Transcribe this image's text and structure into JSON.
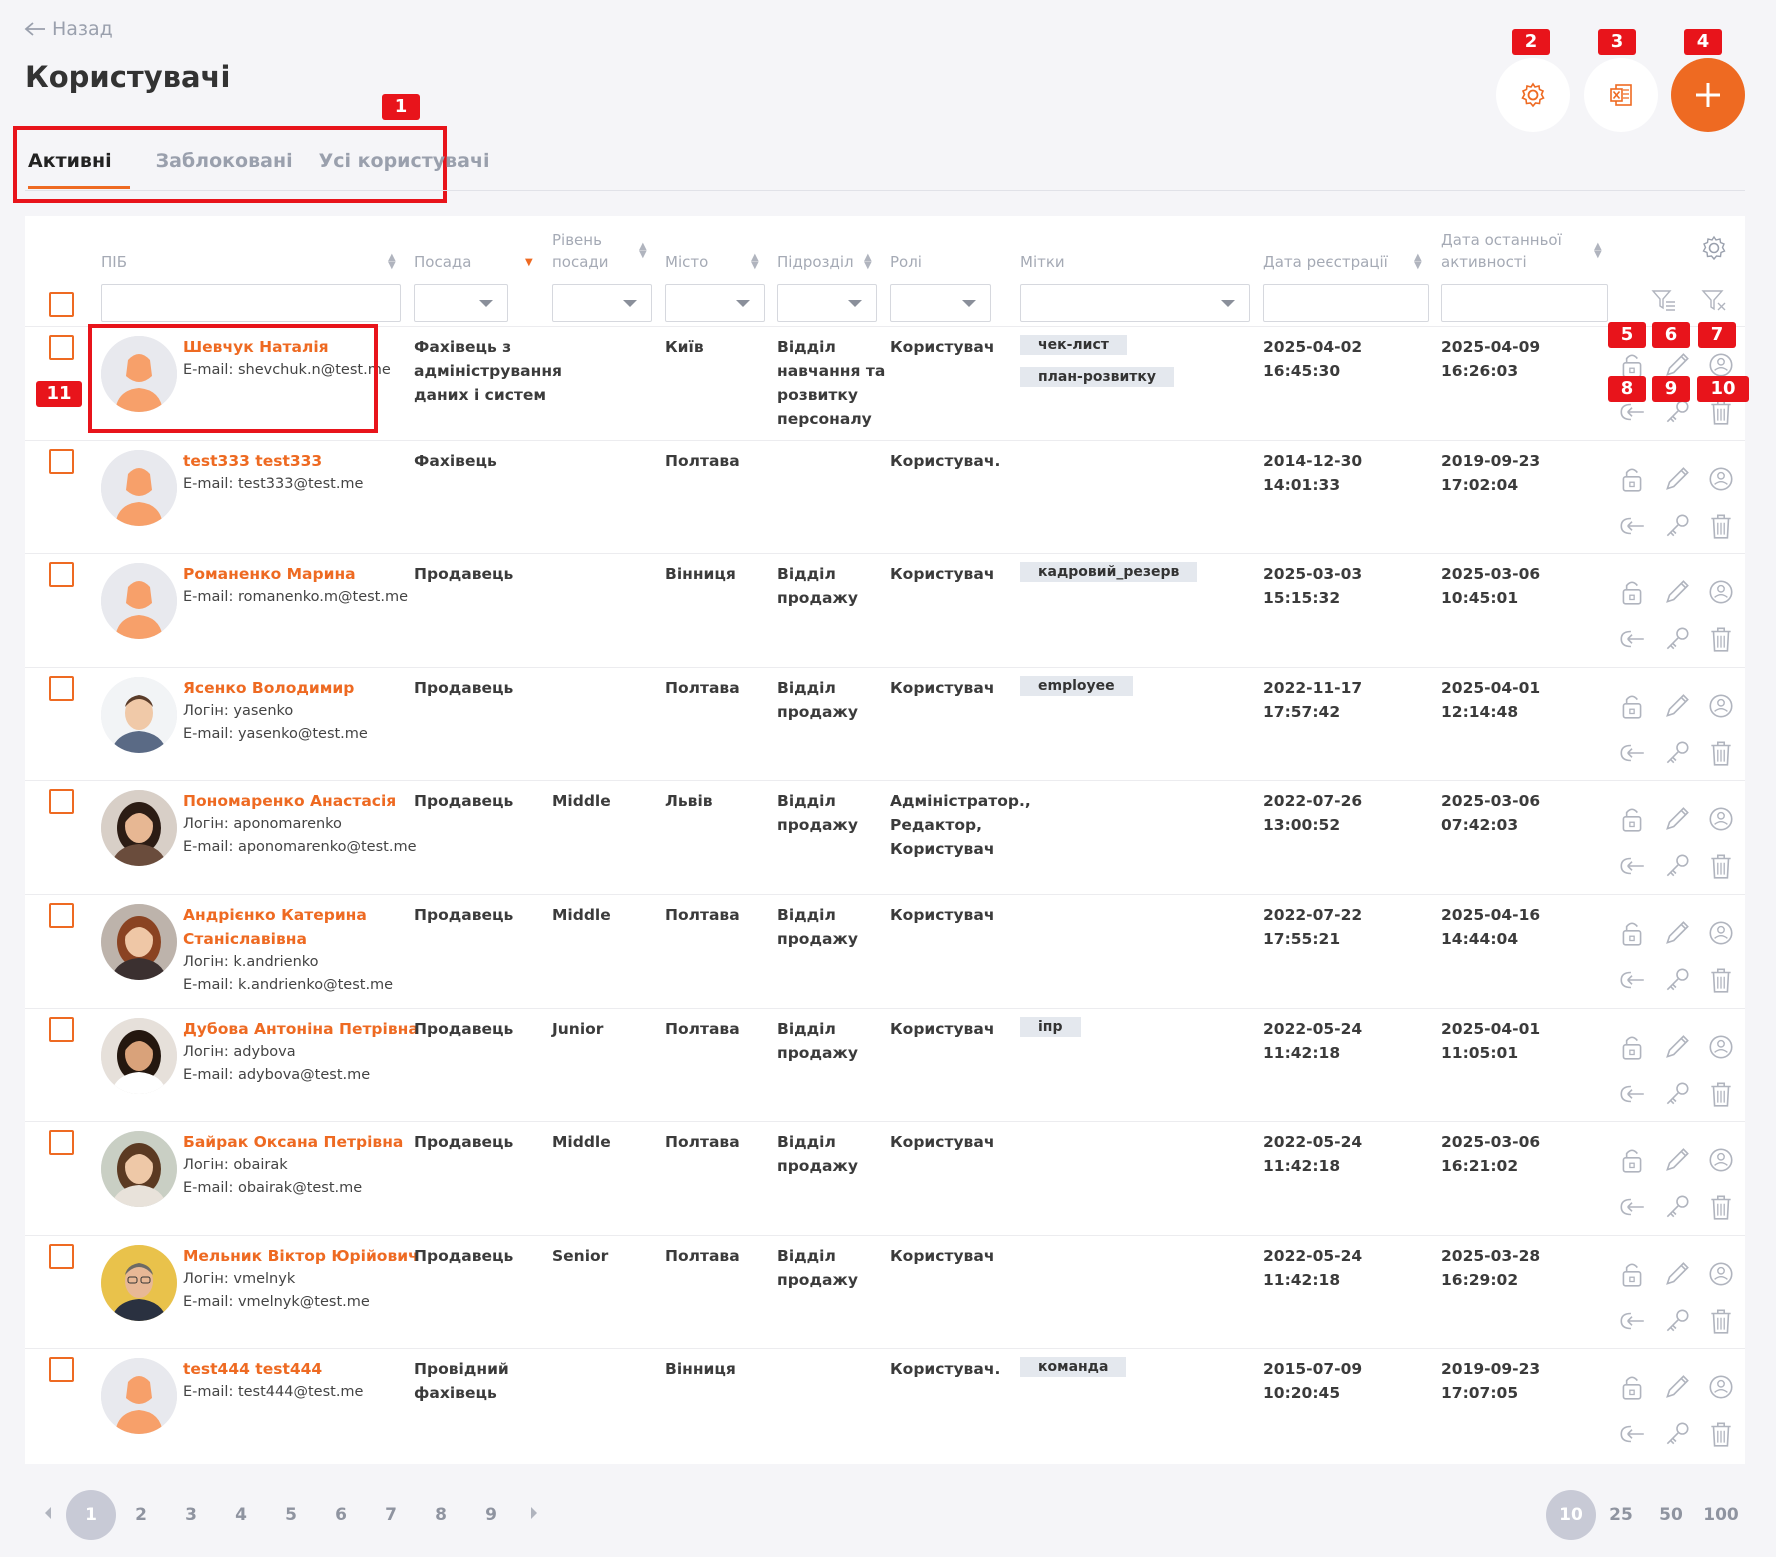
{
  "back_label": "Назад",
  "title": "Користувачі",
  "tabs": [
    "Активні",
    "Заблоковані",
    "Усі користувачі"
  ],
  "toolbar": {
    "settings_icon": "gear-icon",
    "export_icon": "excel-icon",
    "add_icon": "plus-icon"
  },
  "badges": [
    "1",
    "2",
    "3",
    "4",
    "5",
    "6",
    "7",
    "8",
    "9",
    "10",
    "11"
  ],
  "columns": {
    "fio": "ПІБ",
    "position": "Посада",
    "level_line1": "Рівень",
    "level_line2": "посади",
    "city": "Місто",
    "department": "Підрозділ",
    "roles": "Ролі",
    "tags": "Мітки",
    "reg_date": "Дата реєстрації",
    "last_line1": "Дата останньої",
    "last_line2": "активності"
  },
  "users": [
    {
      "name1": "Шевчук Наталія",
      "name2": "",
      "login": "",
      "email": "E-mail: shevchuk.n@test.me",
      "position": [
        "Фахівець з",
        "адміністрування",
        "даних і систем"
      ],
      "level": "",
      "city": "Київ",
      "department": [
        "Відділ",
        "навчання та",
        "розвитку",
        "персоналу"
      ],
      "roles": [
        "Користувач"
      ],
      "tags": [
        "чек-лист",
        "план-розвитку"
      ],
      "reg": [
        "2025-04-02",
        "16:45:30"
      ],
      "last": [
        "2025-04-09",
        "16:26:03"
      ],
      "avatar": "placeholder"
    },
    {
      "name1": "test333 test333",
      "name2": "",
      "login": "",
      "email": "E-mail: test333@test.me",
      "position": [
        "Фахівець"
      ],
      "level": "",
      "city": "Полтава",
      "department": [],
      "roles": [
        "Користувач."
      ],
      "tags": [],
      "reg": [
        "2014-12-30",
        "14:01:33"
      ],
      "last": [
        "2019-09-23",
        "17:02:04"
      ],
      "avatar": "placeholder"
    },
    {
      "name1": "Романенко Марина",
      "name2": "",
      "login": "",
      "email": "E-mail: romanenko.m@test.me",
      "position": [
        "Продавець"
      ],
      "level": "",
      "city": "Вінниця",
      "department": [
        "Відділ",
        "продажу"
      ],
      "roles": [
        "Користувач"
      ],
      "tags": [
        "кадровий_резерв"
      ],
      "reg": [
        "2025-03-03",
        "15:15:32"
      ],
      "last": [
        "2025-03-06",
        "10:45:01"
      ],
      "avatar": "placeholder"
    },
    {
      "name1": "Ясенко Володимир",
      "name2": "",
      "login": "Логін: yasenko",
      "email": "E-mail: yasenko@test.me",
      "position": [
        "Продавець"
      ],
      "level": "",
      "city": "Полтава",
      "department": [
        "Відділ",
        "продажу"
      ],
      "roles": [
        "Користувач"
      ],
      "tags": [
        "employee"
      ],
      "reg": [
        "2022-11-17",
        "17:57:42"
      ],
      "last": [
        "2025-04-01",
        "12:14:48"
      ],
      "avatar": "man-suit"
    },
    {
      "name1": "Пономаренко Анастасія",
      "name2": "",
      "login": "Логін: aponomarenko",
      "email": "E-mail: aponomarenko@test.me",
      "position": [
        "Продавець"
      ],
      "level": "Middle",
      "city": "Львів",
      "department": [
        "Відділ",
        "продажу"
      ],
      "roles": [
        "Адміністратор.,",
        "Редактор,",
        "Користувач"
      ],
      "tags": [],
      "reg": [
        "2022-07-26",
        "13:00:52"
      ],
      "last": [
        "2025-03-06",
        "07:42:03"
      ],
      "avatar": "woman-dark"
    },
    {
      "name1": "Андрієнко Катерина",
      "name2": "Станіславівна",
      "login": "Логін: k.andrienko",
      "email": "E-mail: k.andrienko@test.me",
      "position": [
        "Продавець"
      ],
      "level": "Middle",
      "city": "Полтава",
      "department": [
        "Відділ",
        "продажу"
      ],
      "roles": [
        "Користувач"
      ],
      "tags": [],
      "reg": [
        "2022-07-22",
        "17:55:21"
      ],
      "last": [
        "2025-04-16",
        "14:44:04"
      ],
      "avatar": "woman-red"
    },
    {
      "name1": "Дубова Антоніна Петрівна",
      "name2": "",
      "login": "Логін: adybova",
      "email": "E-mail: adybova@test.me",
      "position": [
        "Продавець"
      ],
      "level": "Junior",
      "city": "Полтава",
      "department": [
        "Відділ",
        "продажу"
      ],
      "roles": [
        "Користувач"
      ],
      "tags": [
        "іпр"
      ],
      "reg": [
        "2022-05-24",
        "11:42:18"
      ],
      "last": [
        "2025-04-01",
        "11:05:01"
      ],
      "avatar": "woman-curly"
    },
    {
      "name1": "Байрак Оксана Петрівна",
      "name2": "",
      "login": "Логін: obairak",
      "email": "E-mail: obairak@test.me",
      "position": [
        "Продавець"
      ],
      "level": "Middle",
      "city": "Полтава",
      "department": [
        "Відділ",
        "продажу"
      ],
      "roles": [
        "Користувач"
      ],
      "tags": [],
      "reg": [
        "2022-05-24",
        "11:42:18"
      ],
      "last": [
        "2025-03-06",
        "16:21:02"
      ],
      "avatar": "woman-brown"
    },
    {
      "name1": "Мельник Віктор Юрійович",
      "name2": "",
      "login": "Логін: vmelnyk",
      "email": "E-mail: vmelnyk@test.me",
      "position": [
        "Продавець"
      ],
      "level": "Senior",
      "city": "Полтава",
      "department": [
        "Відділ",
        "продажу"
      ],
      "roles": [
        "Користувач"
      ],
      "tags": [],
      "reg": [
        "2022-05-24",
        "11:42:18"
      ],
      "last": [
        "2025-03-28",
        "16:29:02"
      ],
      "avatar": "man-glasses"
    },
    {
      "name1": "test444 test444",
      "name2": "",
      "login": "",
      "email": "E-mail: test444@test.me",
      "position": [
        "Провідний",
        "фахівець"
      ],
      "level": "",
      "city": "Вінниця",
      "department": [],
      "roles": [
        "Користувач."
      ],
      "tags": [
        "команда"
      ],
      "reg": [
        "2015-07-09",
        "10:20:45"
      ],
      "last": [
        "2019-09-23",
        "17:07:05"
      ],
      "avatar": "placeholder"
    }
  ],
  "row_actions": [
    "lock-icon",
    "pencil-icon",
    "user-badge-icon",
    "logout-icon",
    "key-icon",
    "trash-icon"
  ],
  "pagination": {
    "pages": [
      "1",
      "2",
      "3",
      "4",
      "5",
      "6",
      "7",
      "8",
      "9"
    ],
    "current": "1"
  },
  "page_sizes": {
    "options": [
      "10",
      "25",
      "50",
      "100"
    ],
    "current": "10"
  },
  "colors": {
    "accent": "#ee6a22",
    "badge": "#e8141b",
    "muted": "#a5aab5",
    "tag_bg": "#e4e8ee"
  }
}
